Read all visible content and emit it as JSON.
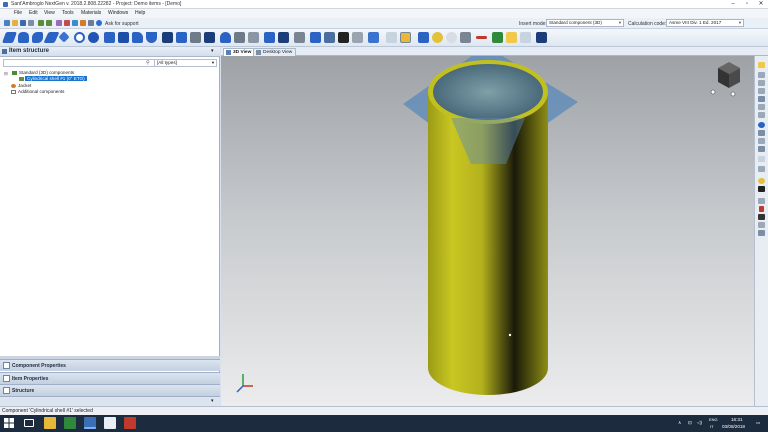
{
  "window": {
    "title": "Sant'Ambrogio NextGen v. 2018.2.808.22282 - Project: Demo items - [Demo]",
    "minimize_icon": "minimize-icon",
    "maximize_icon": "maximize-icon",
    "close_icon": "close-icon"
  },
  "menu": {
    "items": [
      "File",
      "Edit",
      "View",
      "Tools",
      "Materials",
      "Windows",
      "Help"
    ]
  },
  "quickbar": {
    "ask_support": "Ask for support",
    "insert_mode_label": "Insert mode:",
    "insert_mode_value": "Standard component (3D)",
    "calc_code_label": "Calculation code:",
    "calc_code_value": "Asme VIII Div. 1 Ed. 2017"
  },
  "left_panel": {
    "title": "Item structure",
    "filter_value": "[All types]",
    "tree": {
      "standard": "Standard (3D) components",
      "selected": "Cylindrical shell #1 (0° ETO)",
      "jacket": "Jacket",
      "additional": "Additional components"
    },
    "accordions": {
      "component_properties": "Component Properties",
      "item_properties": "Item Properties",
      "structure": "Structure"
    }
  },
  "view_tabs": {
    "view3d": "3D View",
    "desktop": "Desktop View"
  },
  "status": {
    "message": "Component 'Cylindrical shell #1' selected"
  },
  "taskbar": {
    "lang_top": "ENG",
    "lang_bottom": "IT",
    "time": "16:31",
    "date": "03/08/2018"
  },
  "colors": {
    "cylinder": "#c2c01e",
    "plane": "#5d8ab8",
    "selection": "#1874cd"
  }
}
